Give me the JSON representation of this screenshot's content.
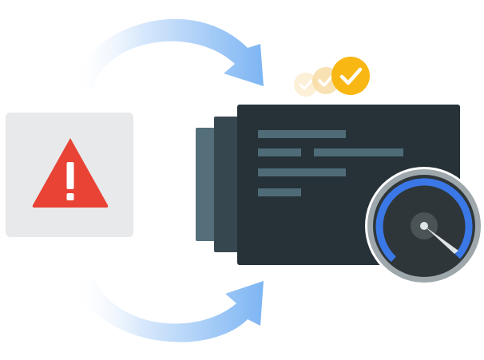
{
  "illustration": {
    "warning_panel": {
      "icon": "warning-triangle-icon",
      "panel_color": "#e8e9eb",
      "triangle_color": "#e84335",
      "glyph_color": "#ffffff"
    },
    "arrows": {
      "icon": "curved-arrow-icon",
      "color": "#7db5f3",
      "fade_color": "#ffffff"
    },
    "checkmarks": {
      "icon": "check-circle-icon",
      "active_color": "#f9b714",
      "faded_count": 2
    },
    "server_card": {
      "icon": "server-card-icon",
      "face_color": "#263238",
      "side_color": "#546e7a",
      "bar_color": "#4f6b78"
    },
    "speedometer": {
      "icon": "speedometer-icon",
      "rim_color": "#9ea7ab",
      "dial_color": "#2f363a",
      "arc_color": "#3b78e7",
      "needle_color": "#dfe4e6"
    }
  }
}
